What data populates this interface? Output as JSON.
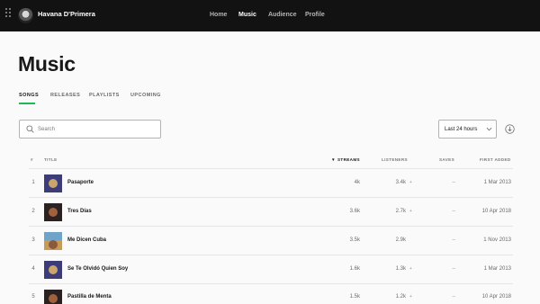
{
  "header": {
    "artist_name": "Havana D'Primera",
    "nav": [
      {
        "label": "Home",
        "active": false
      },
      {
        "label": "Music",
        "active": true
      },
      {
        "label": "Audience",
        "active": false
      },
      {
        "label": "Profile",
        "active": false
      }
    ],
    "icons": {
      "menu": "grid-menu-icon",
      "avatar": "artist-avatar"
    }
  },
  "page": {
    "title": "Music"
  },
  "tabs": [
    {
      "label": "SONGS",
      "active": true
    },
    {
      "label": "RELEASES",
      "active": false
    },
    {
      "label": "PLAYLISTS",
      "active": false
    },
    {
      "label": "UPCOMING",
      "active": false
    }
  ],
  "search": {
    "placeholder": "Search",
    "icon": "search-icon"
  },
  "time_range": {
    "selected": "Last 24 hours",
    "icon": "chevron-down-icon"
  },
  "download": {
    "icon": "download-icon"
  },
  "table": {
    "columns": {
      "rank": "#",
      "title": "TITLE",
      "sort_arrow": "▼",
      "streams": "STREAMS",
      "listeners": "LISTENERS",
      "saves": "SAVES",
      "first_added": "FIRST ADDED"
    },
    "rows": [
      {
        "rank": "1",
        "title": "Pasaporte",
        "streams": "4k",
        "listeners": "3.4k",
        "trend": "+",
        "saves": "–",
        "first_added": "1 Mar 2013"
      },
      {
        "rank": "2",
        "title": "Tres Días",
        "streams": "3.6k",
        "listeners": "2.7k",
        "trend": "+",
        "saves": "–",
        "first_added": "10 Apr 2018"
      },
      {
        "rank": "3",
        "title": "Me Dicen Cuba",
        "streams": "3.5k",
        "listeners": "2.9k",
        "trend": "",
        "saves": "–",
        "first_added": "1 Nov 2013"
      },
      {
        "rank": "4",
        "title": "Se Te Olvidó Quien Soy",
        "streams": "1.6k",
        "listeners": "1.3k",
        "trend": "+",
        "saves": "–",
        "first_added": "1 Mar 2013"
      },
      {
        "rank": "5",
        "title": "Pastilla de Menta",
        "streams": "1.5k",
        "listeners": "1.2k",
        "trend": "+",
        "saves": "–",
        "first_added": "10 Apr 2018"
      }
    ]
  },
  "colors": {
    "topbar": "#121212",
    "accent": "#1db954",
    "background": "#fafafa"
  }
}
